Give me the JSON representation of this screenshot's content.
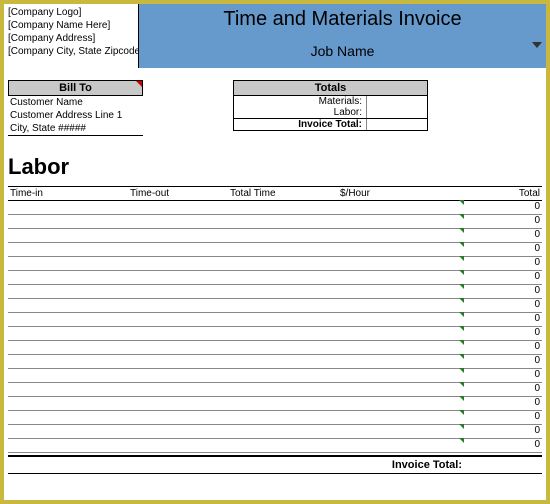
{
  "company": {
    "logo": "[Company Logo]",
    "name": "[Company Name Here]",
    "address": "[Company Address]",
    "city": "[Company City, State Zipcode]"
  },
  "title": {
    "main": "Time and Materials Invoice",
    "sub": "Job Name"
  },
  "billto": {
    "header": "Bill To",
    "name": "Customer Name",
    "address": "Customer Address Line 1",
    "city": "City, State #####"
  },
  "totals": {
    "header": "Totals",
    "materials_label": "Materials:",
    "materials_val": "",
    "labor_label": "Labor:",
    "labor_val": "",
    "invoice_label": "Invoice Total:",
    "invoice_val": ""
  },
  "labor": {
    "title": "Labor",
    "headers": {
      "timein": "Time-in",
      "timeout": "Time-out",
      "totaltime": "Total Time",
      "rate": "$/Hour",
      "total": "Total"
    },
    "rows": [
      {
        "total": "0"
      },
      {
        "total": "0"
      },
      {
        "total": "0"
      },
      {
        "total": "0"
      },
      {
        "total": "0"
      },
      {
        "total": "0"
      },
      {
        "total": "0"
      },
      {
        "total": "0"
      },
      {
        "total": "0"
      },
      {
        "total": "0"
      },
      {
        "total": "0"
      },
      {
        "total": "0"
      },
      {
        "total": "0"
      },
      {
        "total": "0"
      },
      {
        "total": "0"
      },
      {
        "total": "0"
      },
      {
        "total": "0"
      },
      {
        "total": "0"
      }
    ],
    "invoice_total_label": "Invoice Total:"
  }
}
